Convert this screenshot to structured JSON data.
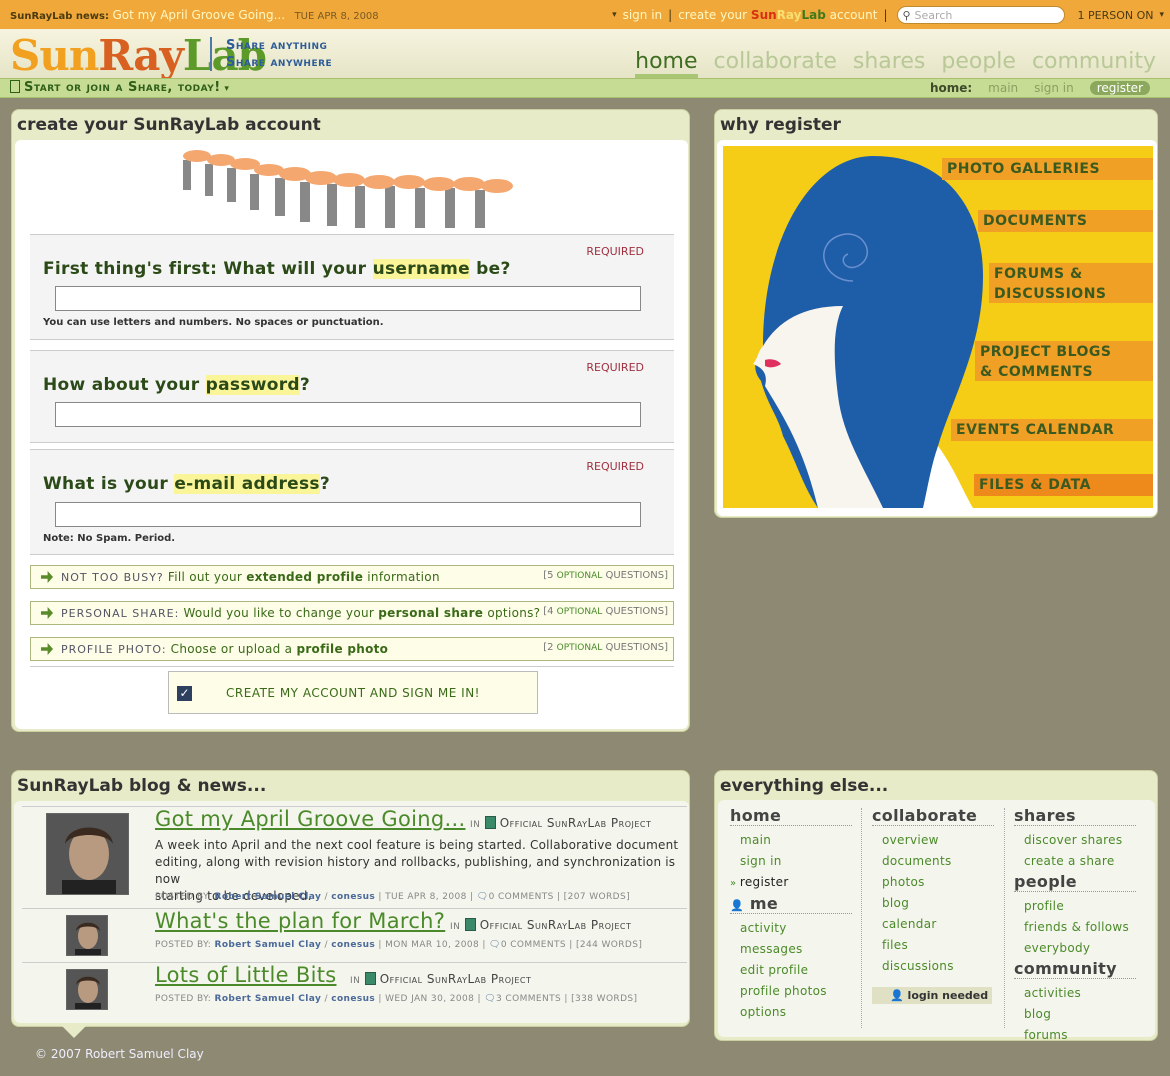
{
  "topbar": {
    "news_label": "SunRayLab news:",
    "news_link": "Got my April Groove Going...",
    "news_date": "TUE APR 8, 2008",
    "sign_in": "sign in",
    "create_pre": "create your",
    "create_sun": "Sun",
    "create_ray": "Ray",
    "create_lab": "Lab",
    "create_post": "account",
    "separator": "|",
    "search_placeholder": "Search",
    "person_on": "1 PERSON ON"
  },
  "logo": {
    "sun": "Sun",
    "ray": "Ray",
    "lab": "Lab"
  },
  "tagline": {
    "line1": "Share anything",
    "line2": "Share anywhere"
  },
  "mainnav": [
    "home",
    "collaborate",
    "shares",
    "people",
    "community"
  ],
  "subbar": {
    "left": "Start or join a Share, today!",
    "crumb": "home:",
    "links": [
      "main",
      "sign in",
      "register"
    ]
  },
  "create": {
    "title": "create your SunRayLab account",
    "required": "REQUIRED",
    "username_q_pre": "First thing's first: What will your",
    "username_q_hl": "username",
    "username_q_post": "be?",
    "username_hint": "You can use letters and numbers. No spaces or punctuation.",
    "password_q_pre": "How about your",
    "password_q_hl": "password",
    "password_q_post": "?",
    "email_q_pre": "What is your",
    "email_q_hl": "e-mail address",
    "email_q_post": "?",
    "email_hint": "Note: No Spam. Period.",
    "optional": [
      {
        "key": "NOT TOO BUSY?",
        "pre": "Fill out your",
        "bold": "extended profile",
        "post": "information",
        "count": "[5",
        "opt": "OPTIONAL",
        "q": "QUESTIONS]"
      },
      {
        "key": "PERSONAL SHARE:",
        "pre": "Would you like to change your",
        "bold": "personal share",
        "post": "options?",
        "count": "[4",
        "opt": "OPTIONAL",
        "q": "QUESTIONS]"
      },
      {
        "key": "PROFILE PHOTO:",
        "pre": "Choose or upload a",
        "bold": "profile photo",
        "post": "",
        "count": "[2",
        "opt": "OPTIONAL",
        "q": "QUESTIONS]"
      }
    ],
    "submit": "CREATE MY ACCOUNT AND SIGN ME IN!",
    "check": "✓"
  },
  "why": {
    "title": "why register",
    "features": [
      "PHOTO GALLERIES",
      "DOCUMENTS",
      "FORUMS &",
      "DISCUSSIONS",
      "PROJECT BLOGS",
      "& COMMENTS",
      "EVENTS CALENDAR",
      "FILES & DATA"
    ]
  },
  "blog": {
    "title": "SunRayLab blog & news...",
    "in": "IN",
    "project": "Official SunRayLab Project",
    "posted_by": "POSTED BY:",
    "author": "Robert Samuel Clay",
    "slash": "/",
    "handle": "conesus",
    "entries": [
      {
        "title": "Got my April Groove Going...",
        "text1": "A week into April and the next cool feature is being started. Collaborative document",
        "text2": "editing, along with revision history and rollbacks, publishing, and synchronization is now",
        "text3": "starting to be developed.",
        "date": "| TUE APR 8, 2008 |",
        "comments": "0 COMMENTS",
        "words": "| [207 WORDS]"
      },
      {
        "title": "What's the plan for March?",
        "date": "| MON MAR 10, 2008 |",
        "comments": "0 COMMENTS",
        "words": "| [244 WORDS]"
      },
      {
        "title": "Lots of Little Bits",
        "date": "| WED JAN 30, 2008 |",
        "comments": "3 COMMENTS",
        "words": "| [338 WORDS]"
      }
    ]
  },
  "everything": {
    "title": "everything else...",
    "home": {
      "h": "home",
      "items": [
        "main",
        "sign in",
        "register"
      ]
    },
    "me": {
      "h": "me",
      "items": [
        "activity",
        "messages",
        "edit profile",
        "profile photos",
        "options"
      ]
    },
    "collaborate": {
      "h": "collaborate",
      "items": [
        "overview",
        "documents",
        "photos",
        "blog",
        "calendar",
        "files",
        "discussions"
      ]
    },
    "login_needed": "login needed",
    "shares": {
      "h": "shares",
      "items": [
        "discover shares",
        "create a share"
      ]
    },
    "people": {
      "h": "people",
      "items": [
        "profile",
        "friends & follows",
        "everybody"
      ]
    },
    "community": {
      "h": "community",
      "items": [
        "activities",
        "blog",
        "forums"
      ]
    }
  },
  "footer": "© 2007 Robert Samuel Clay",
  "colors": {
    "orange": "#f0a83b",
    "green": "#4b8a2a",
    "background": "#8e8972",
    "poster_yellow": "#f5cc16",
    "spiral_blue": "#1e5ea8"
  }
}
